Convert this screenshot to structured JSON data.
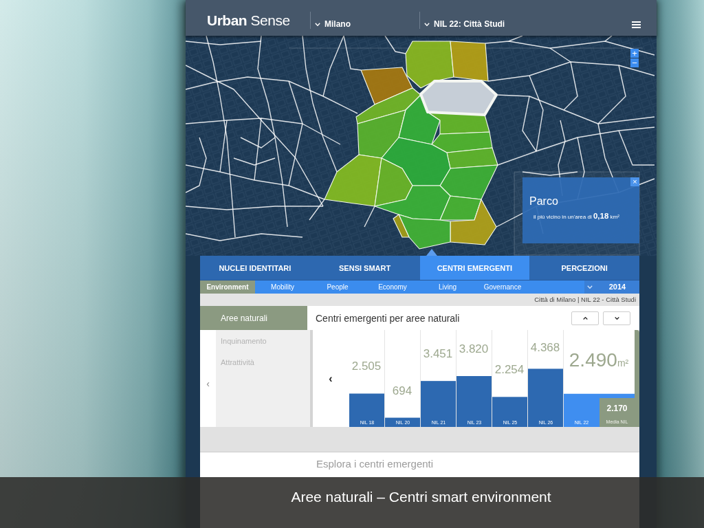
{
  "header": {
    "logo": "**Urban** Sense",
    "selectors": [
      {
        "value": "Milano"
      },
      {
        "value": "NIL 22: Città Studi"
      }
    ]
  },
  "map": {
    "zoom_controls": [
      "+",
      "−"
    ],
    "popup": {
      "title": "Parco",
      "detail": "il più vicino in un'area di **0,18** km²",
      "close": "×"
    }
  },
  "tabs": [
    {
      "label": "NUCLEI IDENTITARI",
      "selected": false
    },
    {
      "label": "SENSI SMART",
      "selected": false
    },
    {
      "label": "CENTRI EMERGENTI",
      "selected": true
    },
    {
      "label": "PERCEZIONI",
      "selected": false
    }
  ],
  "subtabs": [
    {
      "label": "Environment",
      "selected": true
    },
    {
      "label": "Mobility",
      "selected": false
    },
    {
      "label": "People",
      "selected": false
    },
    {
      "label": "Economy",
      "selected": false
    },
    {
      "label": "Living",
      "selected": false
    },
    {
      "label": "Governance",
      "selected": false
    }
  ],
  "year_selector": {
    "value": "2014"
  },
  "breadcrumb": "Città di Milano | NIL 22 - Città Studi",
  "categories": {
    "back": "‹",
    "items": [
      {
        "label": "Aree naturali",
        "selected": true
      },
      {
        "label": "Inquinamento",
        "selected": false
      },
      {
        "label": "Attrattività",
        "selected": false
      }
    ]
  },
  "panel": {
    "title": "Centri emergenti per aree naturali",
    "chart": {
      "prev": "‹",
      "unit": "m²",
      "bars": [
        {
          "selected": false
        },
        {
          "selected": false
        },
        {
          "selected": false
        },
        {
          "selected": false
        },
        {
          "selected": false
        },
        {
          "selected": false
        },
        {
          "selected": true
        }
      ],
      "average": {
        "value": "2.170",
        "label": "Media NIL",
        "level": 0.87
      },
      "chart_data": {
        "type": "bar",
        "categories": [
          "NIL 18",
          "NIL 20",
          "NIL 21",
          "NIL 23",
          "NIL 25",
          "NIL 26",
          "NIL 22"
        ],
        "values": [
          2505,
          694,
          3451,
          3820,
          2254,
          4368,
          2490
        ],
        "value_labels": [
          "2.505",
          "694",
          "3.451",
          "3.820",
          "2.254",
          "4.368",
          "2.490"
        ]
      }
    }
  },
  "explore_link": "Esplora i centri emergenti",
  "caption": "Aree naturali – Centri smart environment"
}
